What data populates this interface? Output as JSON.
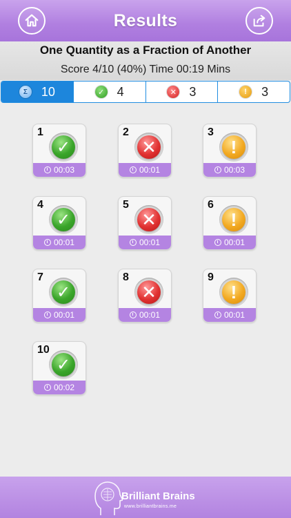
{
  "header": {
    "title": "Results",
    "home_icon": "home-icon",
    "share_icon": "share-icon"
  },
  "summary": {
    "topic": "One Quantity as a Fraction of Another",
    "score_line": "Score 4/10  (40%) Time 00:19 Mins"
  },
  "stats": {
    "total": "10",
    "correct": "4",
    "wrong": "3",
    "skipped": "3"
  },
  "questions": [
    {
      "num": "1",
      "status": "correct",
      "time": "00:03"
    },
    {
      "num": "2",
      "status": "wrong",
      "time": "00:01"
    },
    {
      "num": "3",
      "status": "skipped",
      "time": "00:03"
    },
    {
      "num": "4",
      "status": "correct",
      "time": "00:01"
    },
    {
      "num": "5",
      "status": "wrong",
      "time": "00:01"
    },
    {
      "num": "6",
      "status": "skipped",
      "time": "00:01"
    },
    {
      "num": "7",
      "status": "correct",
      "time": "00:01"
    },
    {
      "num": "8",
      "status": "wrong",
      "time": "00:01"
    },
    {
      "num": "9",
      "status": "skipped",
      "time": "00:01"
    },
    {
      "num": "10",
      "status": "correct",
      "time": "00:02"
    }
  ],
  "footer": {
    "brand": "Brilliant Brains",
    "url": "www.brilliantbrains.me"
  },
  "colors": {
    "header": "#b07fe0",
    "accent_blue": "#1d86dc",
    "correct": "#3aa52a",
    "wrong": "#e13232",
    "skipped": "#f2a922"
  }
}
